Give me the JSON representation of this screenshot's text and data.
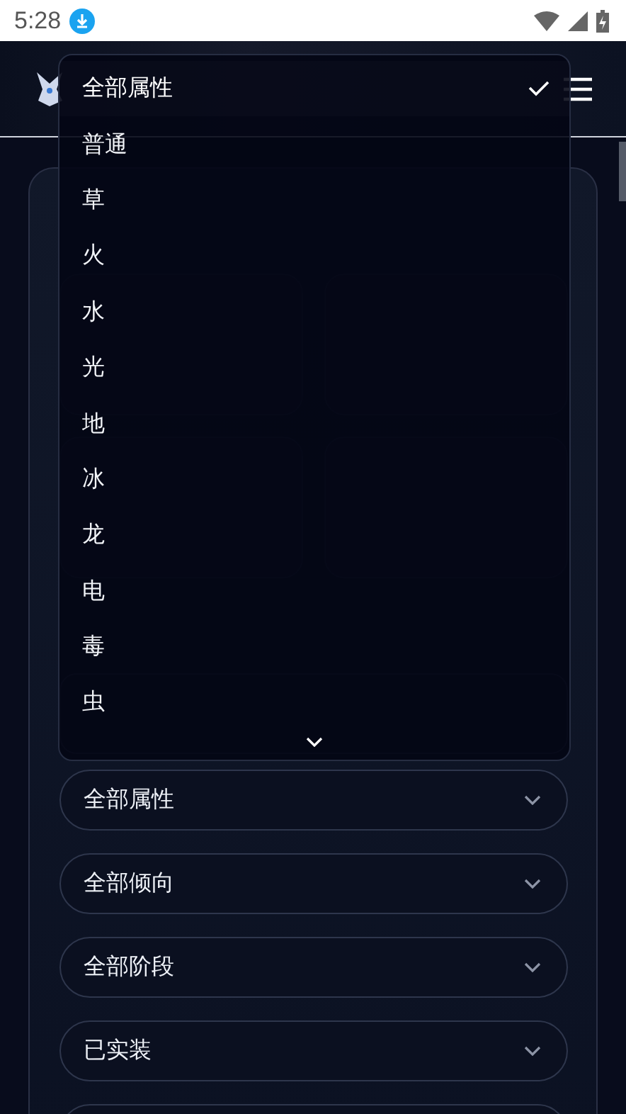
{
  "status_bar": {
    "time": "5:28"
  },
  "filters": [
    {
      "value": "全部属性",
      "kind": "select"
    },
    {
      "value": "全部倾向",
      "kind": "select"
    },
    {
      "value": "全部阶段",
      "kind": "select"
    },
    {
      "value": "已实装",
      "kind": "select"
    }
  ],
  "dropdown": {
    "items": [
      {
        "label": "全部属性",
        "selected": true
      },
      {
        "label": "普通",
        "selected": false
      },
      {
        "label": "草",
        "selected": false
      },
      {
        "label": "火",
        "selected": false
      },
      {
        "label": "水",
        "selected": false
      },
      {
        "label": "光",
        "selected": false
      },
      {
        "label": "地",
        "selected": false
      },
      {
        "label": "冰",
        "selected": false
      },
      {
        "label": "龙",
        "selected": false
      },
      {
        "label": "电",
        "selected": false
      },
      {
        "label": "毒",
        "selected": false
      },
      {
        "label": "虫",
        "selected": false
      }
    ]
  }
}
